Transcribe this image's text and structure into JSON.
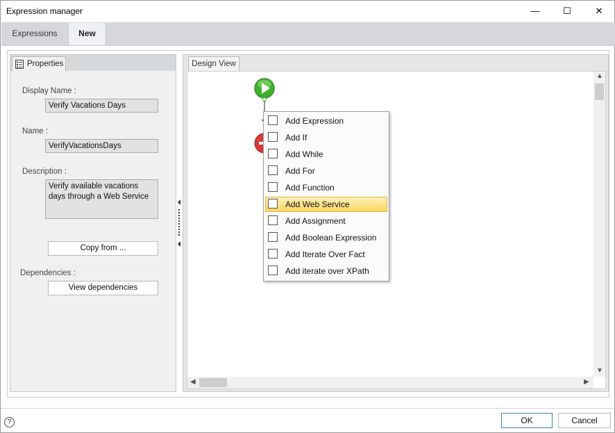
{
  "window": {
    "title": "Expression manager",
    "controls": {
      "minimize": "—",
      "maximize": "☐",
      "close": "✕"
    }
  },
  "tabs": [
    {
      "label": "Expressions",
      "active": false
    },
    {
      "label": "New",
      "active": true
    }
  ],
  "properties_panel": {
    "tab_label": "Properties",
    "display_name_label": "Display Name :",
    "display_name_value": "Verify Vacations Days",
    "name_label": "Name :",
    "name_value": "VerifyVacationsDays",
    "description_label": "Description :",
    "description_value": "Verify available vacations days through a Web Service",
    "copy_from_button": "Copy from ...",
    "dependencies_label": "Dependencies :",
    "view_dependencies_button": "View dependencies"
  },
  "design_view": {
    "tab_label": "Design View",
    "start_node_color": "#3fae2a",
    "stop_node_color": "#d83a3a"
  },
  "context_menu": {
    "items": [
      {
        "label": "Add Expression",
        "icon": "expression-icon",
        "highlighted": false
      },
      {
        "label": "Add If",
        "icon": "if-icon",
        "highlighted": false
      },
      {
        "label": "Add While",
        "icon": "while-icon",
        "highlighted": false
      },
      {
        "label": "Add For",
        "icon": "for-icon",
        "highlighted": false
      },
      {
        "label": "Add Function",
        "icon": "function-icon",
        "highlighted": false
      },
      {
        "label": "Add Web Service",
        "icon": "web-service-icon",
        "highlighted": true
      },
      {
        "label": "Add Assignment",
        "icon": "assignment-icon",
        "highlighted": false
      },
      {
        "label": "Add Boolean Expression",
        "icon": "boolean-expression-icon",
        "highlighted": false
      },
      {
        "label": "Add Iterate Over Fact",
        "icon": "iterate-fact-icon",
        "highlighted": false
      },
      {
        "label": "Add iterate over XPath",
        "icon": "iterate-xpath-icon",
        "highlighted": false
      }
    ],
    "highlight_color": "#fbd566"
  },
  "footer": {
    "help_icon": "?",
    "ok_button": "OK",
    "cancel_button": "Cancel"
  }
}
